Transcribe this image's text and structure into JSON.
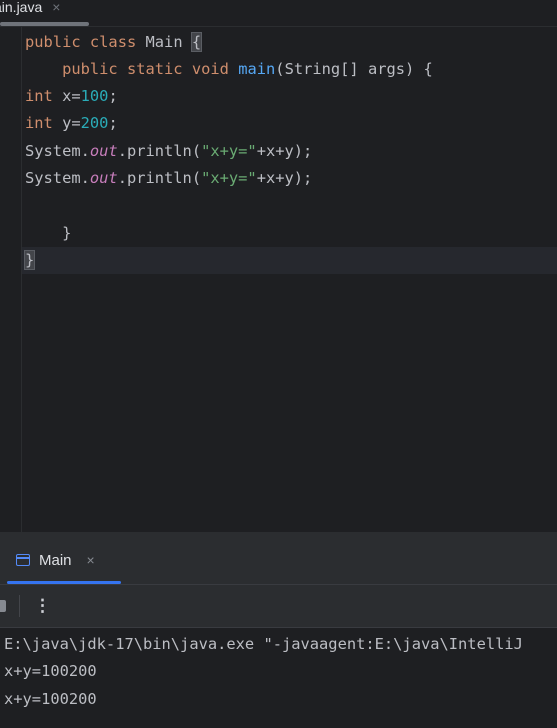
{
  "editor_tab": {
    "label": "ain.java",
    "close": "×"
  },
  "code": {
    "line1": {
      "kw1": "public",
      "kw2": "class",
      "name": "Main",
      "brace": "{"
    },
    "line2": {
      "kw1": "public",
      "kw2": "static",
      "kw3": "void",
      "fn": "main",
      "rest": "(String[] args) {"
    },
    "line3": {
      "kw": "int",
      "var": " x=",
      "num": "100",
      "end": ";"
    },
    "line4": {
      "kw": "int",
      "var": " y=",
      "num": "200",
      "end": ";"
    },
    "line5": {
      "obj": "System.",
      "field": "out",
      "call": ".println(",
      "str": "\"x+y=\"",
      "rest": "+x+y);"
    },
    "line6": {
      "obj": "System.",
      "field": "out",
      "call": ".println(",
      "str": "\"x+y=\"",
      "rest": "+x+y);"
    },
    "line8": {
      "brace": "}"
    },
    "line9": {
      "brace": "}"
    }
  },
  "run_panel": {
    "tab_label": "Main",
    "tab_close": "×",
    "more_icon": "⋮"
  },
  "console": {
    "lines": [
      "E:\\java\\jdk-17\\bin\\java.exe \"-javaagent:E:\\java\\IntelliJ",
      "x+y=100200",
      "x+y=100200"
    ]
  },
  "colors": {
    "background": "#1e1f22",
    "keyword": "#cf8e6d",
    "function": "#56a8f5",
    "number": "#2aacb8",
    "string": "#6aab73",
    "static_field": "#c77dbb",
    "accent": "#3574f0"
  }
}
